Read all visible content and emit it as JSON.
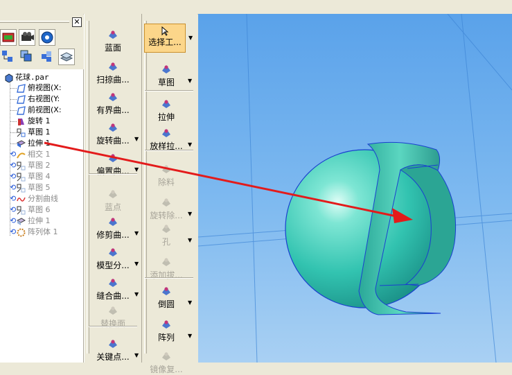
{
  "tree": {
    "root_label": "花球.par",
    "items": [
      {
        "label": "俯视图(X:",
        "dim": false,
        "rollback": false,
        "icon": "plane-icon"
      },
      {
        "label": "右视图(Y:",
        "dim": false,
        "rollback": false,
        "icon": "plane-icon"
      },
      {
        "label": "前视图(X:",
        "dim": false,
        "rollback": false,
        "icon": "plane-icon"
      },
      {
        "label": "旋转 1",
        "dim": false,
        "rollback": false,
        "icon": "revolve-icon"
      },
      {
        "label": "草图 1",
        "dim": false,
        "rollback": false,
        "icon": "sketch-icon"
      },
      {
        "label": "拉伸 1",
        "dim": false,
        "rollback": false,
        "icon": "extrude-icon"
      },
      {
        "label": "相交 1",
        "dim": true,
        "rollback": true,
        "icon": "intersect-icon"
      },
      {
        "label": "草图 2",
        "dim": true,
        "rollback": true,
        "icon": "sketch-icon"
      },
      {
        "label": "草图 4",
        "dim": true,
        "rollback": true,
        "icon": "sketch-icon"
      },
      {
        "label": "草图 5",
        "dim": true,
        "rollback": true,
        "icon": "sketch-icon"
      },
      {
        "label": "分割曲线",
        "dim": true,
        "rollback": true,
        "icon": "split-curve-icon"
      },
      {
        "label": "草图 6",
        "dim": true,
        "rollback": true,
        "icon": "sketch-icon"
      },
      {
        "label": "拉伸 1",
        "dim": true,
        "rollback": true,
        "icon": "extrude-icon"
      },
      {
        "label": "阵列体 1",
        "dim": true,
        "rollback": true,
        "icon": "pattern-icon"
      }
    ]
  },
  "ribbon_col1": {
    "buttons": [
      {
        "label": "蓝面",
        "icon": "blue-surface-icon",
        "disabled": false,
        "dropdown": false
      },
      {
        "label": "扫掠曲...",
        "icon": "swept-surface-icon",
        "disabled": false,
        "dropdown": false
      },
      {
        "label": "有界曲...",
        "icon": "bounded-surface-icon",
        "disabled": false,
        "dropdown": false
      },
      {
        "label": "旋转曲...",
        "icon": "revolved-surface-icon",
        "disabled": false,
        "dropdown": true
      },
      {
        "label": "偏置曲...",
        "icon": "offset-surface-icon",
        "disabled": false,
        "dropdown": true
      },
      {
        "label": "蓝点",
        "icon": "blue-dot-icon",
        "disabled": true,
        "dropdown": false
      },
      {
        "label": "修剪曲...",
        "icon": "trim-surface-icon",
        "disabled": false,
        "dropdown": true
      },
      {
        "label": "模型分...",
        "icon": "split-body-icon",
        "disabled": false,
        "dropdown": true
      },
      {
        "label": "缝合曲...",
        "icon": "stitch-surface-icon",
        "disabled": false,
        "dropdown": true
      },
      {
        "label": "替换面",
        "icon": "replace-face-icon",
        "disabled": true,
        "dropdown": false
      },
      {
        "label": "关键点...",
        "icon": "keypoint-icon",
        "disabled": false,
        "dropdown": true
      }
    ]
  },
  "ribbon_col2": {
    "select_label": "选择工...",
    "buttons": [
      {
        "label": "草图",
        "icon": "sketch-icon",
        "disabled": false,
        "dropdown": true
      },
      {
        "label": "拉伸",
        "icon": "extrude-icon",
        "disabled": false,
        "dropdown": false
      },
      {
        "label": "放样拉...",
        "icon": "loft-icon",
        "disabled": false,
        "dropdown": true
      },
      {
        "label": "除料",
        "icon": "cutout-icon",
        "disabled": true,
        "dropdown": false
      },
      {
        "label": "旋转除...",
        "icon": "revolved-cutout-icon",
        "disabled": true,
        "dropdown": true
      },
      {
        "label": "孔",
        "icon": "hole-icon",
        "disabled": true,
        "dropdown": true
      },
      {
        "label": "添加拔...",
        "icon": "draft-icon",
        "disabled": true,
        "dropdown": false
      },
      {
        "label": "倒圆",
        "icon": "round-icon",
        "disabled": false,
        "dropdown": true
      },
      {
        "label": "阵列",
        "icon": "pattern-icon",
        "disabled": false,
        "dropdown": true
      },
      {
        "label": "镜像复...",
        "icon": "mirror-icon",
        "disabled": true,
        "dropdown": false
      }
    ]
  },
  "colors": {
    "viewport_bg": "#5fa7ea",
    "sphere": "#39c9b6",
    "arrow": "#e31b1b",
    "select_highlight": "#fcd68a"
  }
}
